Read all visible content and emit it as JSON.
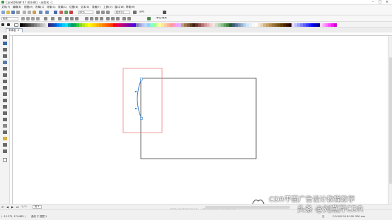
{
  "window": {
    "title": "CorelDRAW X7 (64-Bit) - 未命名 -1",
    "controls": [
      "–",
      "□",
      "×"
    ]
  },
  "menu": [
    "文件(F)",
    "编辑(E)",
    "视图(V)",
    "布局(L)",
    "对象(C)",
    "效果(C)",
    "位图(B)",
    "文本(X)",
    "表格(T)",
    "工具(O)",
    "窗口(W)",
    "帮助(H)"
  ],
  "toolbar": {
    "zoom_value": "50%",
    "snap_label": "贴齐(T)",
    "launch_label": "启动"
  },
  "propertybar": {
    "paper_label": "纸张",
    "units_label": "单位:毫米"
  },
  "document_tab": "未命名 -1",
  "palette": {
    "colors": [
      "#000000",
      "#1a1a1a",
      "#333333",
      "#4d4d4d",
      "#666666",
      "#808080",
      "#999999",
      "#b3b3b3",
      "#cccccc",
      "#e6e6e6",
      "#2b2b80",
      "#1f3f9f",
      "#0059c9",
      "#0080ff",
      "#00a6ff",
      "#00ccff",
      "#00e6e6",
      "#00b3a6",
      "#009966",
      "#00b34d",
      "#33cc33",
      "#80d926",
      "#b3e619",
      "#e6f200",
      "#ffff00",
      "#ffe600",
      "#ffcc00",
      "#ffb300",
      "#ff9900",
      "#ff8000",
      "#ff6600",
      "#ff4d00",
      "#ff3300",
      "#ff0000",
      "#e6004d",
      "#cc0066",
      "#b30080",
      "#990099",
      "#800099",
      "#6600cc",
      "#4d00e6",
      "#8080c0",
      "#a0a0d8",
      "#c0c0f0",
      "#b3d9ff",
      "#99ccff",
      "#80ffcc",
      "#99ff99",
      "#ccff99",
      "#ffff99",
      "#ffe699",
      "#ffcc99",
      "#ffb399",
      "#ff9999",
      "#ff99cc",
      "#ff99ff",
      "#d9b3ff",
      "#c0a080",
      "#a07850",
      "#806040",
      "#604020",
      "#402010",
      "#703030",
      "#905050",
      "#b07070",
      "#d09090",
      "#e0b0b0",
      "#f0d0d0",
      "#ffe0e0",
      "#c8e0c8",
      "#a8d0a8",
      "#88c088",
      "#60a060",
      "#408040",
      "#206020",
      "#3c5a78",
      "#5a7896",
      "#7896b4",
      "#96b4d2",
      "#b4d2f0",
      "#d2e6fa",
      "#e8f0f8",
      "#f8f8f8",
      "#ffffff",
      "#f5e6d2",
      "#e6d2b4",
      "#d2b48c",
      "#c8a064",
      "#b48c50",
      "#a0783c",
      "#8c6428",
      "#785014",
      "#643c00",
      "#502800",
      "#3c1400",
      "#280000",
      "#e0e0ff",
      "#c0c0ff",
      "#a0a0ff",
      "#8080ff",
      "#6060ff",
      "#4040ff",
      "#2020ff",
      "#0000ff",
      "#0000c0",
      "#000080",
      "#ffd0ff",
      "#ffa0ff",
      "#ff70ff",
      "#ff40ff",
      "#ff10ff",
      "#d000d0"
    ],
    "ruler_unit": "毫米"
  },
  "pager": {
    "first": "⏮",
    "prev": "◀",
    "page_info": "1 / 1",
    "next": "▶",
    "last": "⏭",
    "page_name": "页 1"
  },
  "canvas_hint": "将颜色(或对象)拖动至此处，以便将这些颜色与文档存储在一起",
  "status": {
    "coords": "( -12.271, 174.882 )",
    "selection": "曲线 于 图层 1",
    "color_info": "C:0 M:0 Y:0 K:100  .200 mm",
    "fill_label": "无"
  },
  "watermark": {
    "line1": "CDR平面广告设计教程教学",
    "line2": "头条 @刘燕芹CDR"
  },
  "colors": {
    "selection_box": "#f08080",
    "rectangle_stroke": "#444444",
    "curve_stroke": "#3a7fc1",
    "node_color": "#3a7fc1"
  }
}
